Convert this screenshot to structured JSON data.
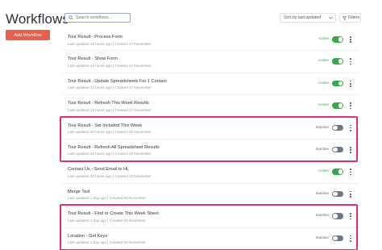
{
  "header": {
    "title": "Workflows",
    "add_label": "Add Workflow",
    "search_placeholder": "Search workflows...",
    "sort_label": "Sort by last updated",
    "filters_label": "Filters"
  },
  "colors": {
    "accent": "#e8604c",
    "active": "#35a94d",
    "highlight": "#e0306e",
    "toggle_off": "#6d7788"
  },
  "workflows": [
    {
      "name": "Tour Result - Process Form",
      "meta": "Last updated 13 hours ago  |  Created 17 November",
      "status": "Active",
      "enabled": true
    },
    {
      "name": "Tour Result - Show Form",
      "meta": "Last updated 13 hours ago  |  Created 17 November",
      "status": "Active",
      "enabled": true
    },
    {
      "name": "Tour Result - Update Spreadsheets For 1 Contact",
      "meta": "Last updated 13 hours ago  |  Created 17 November",
      "status": "Active",
      "enabled": true
    },
    {
      "name": "Tour Result - Refresh This Week Results",
      "meta": "Last updated 13 hours ago  |  Created 17 November",
      "status": "Active",
      "enabled": true
    },
    {
      "name": "Tour Result - Set Included This Week",
      "meta": "Last updated 20 hours ago  |  Created 20 November",
      "status": "Inactive",
      "enabled": false
    },
    {
      "name": "Tour Result - Refresh All Spreadsheet Results",
      "meta": "Last updated 20 hours ago  |  Created 20 November",
      "status": "Inactive",
      "enabled": false
    },
    {
      "name": "Contact Us - Send Email to HL",
      "meta": "Last updated 20 hours ago  |  Created 20 November",
      "status": "Active",
      "enabled": true
    },
    {
      "name": "Merge Test",
      "meta": "Last updated 1 day ago  |  Created 20 November",
      "status": "Inactive",
      "enabled": false
    },
    {
      "name": "Tour Result - Find or Create This Week Sheet",
      "meta": "Last updated 1 day ago  |  Created 20 November",
      "status": "Inactive",
      "enabled": false
    },
    {
      "name": "Location - Get Keys",
      "meta": "Last updated 1 day ago  |  Created 20 November",
      "status": "Inactive",
      "enabled": false
    }
  ],
  "annotations": [
    {
      "label": "highlight-group-1",
      "rows": [
        4,
        5
      ]
    },
    {
      "label": "highlight-group-2",
      "rows": [
        8,
        9
      ]
    }
  ]
}
